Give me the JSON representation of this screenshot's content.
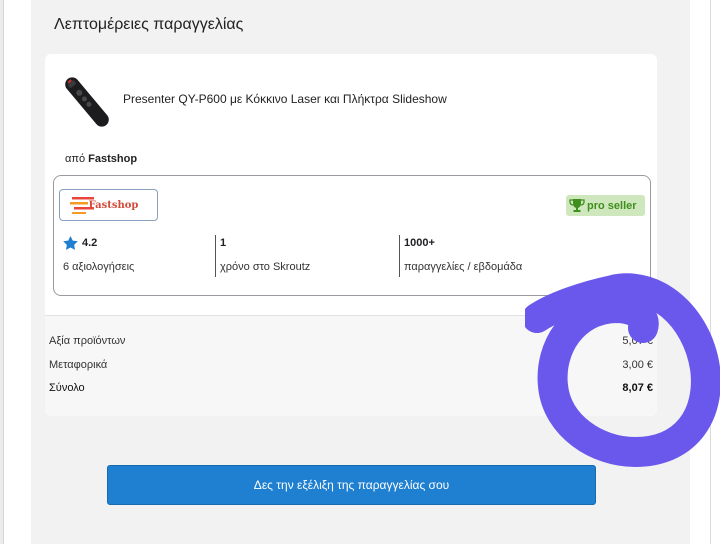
{
  "page": {
    "title": "Λεπτομέρειες παραγγελίας"
  },
  "product": {
    "name": "Presenter QY-P600 με Κόκκινο Laser και Πλήκτρα Slideshow",
    "image_icon": "laser-presenter-remote-icon"
  },
  "seller": {
    "prefix": "από",
    "name": "Fastshop",
    "logo_text": "Fastshop",
    "pro_badge": "pro seller",
    "stats": [
      {
        "value": "4.2",
        "label": "6 αξιολογήσεις",
        "icon": "star-icon"
      },
      {
        "value": "1",
        "label": "χρόνο στο Skroutz"
      },
      {
        "value": "1000+",
        "label": "παραγγελίες / εβδομάδα"
      }
    ]
  },
  "totals": [
    {
      "label": "Αξία προϊόντων",
      "amount": "5,07 €"
    },
    {
      "label": "Μεταφορικά",
      "amount": "3,00 €"
    },
    {
      "label": "Σύνολο",
      "amount": "8,07 €"
    }
  ],
  "cta": {
    "label": "Δες την εξέλιξη της παραγγελίας σου"
  },
  "colors": {
    "accent": "#1f7fd0",
    "annotation_circle": "#6a58ec",
    "pro_badge_bg": "#cfe7bd",
    "star": "#1f7fd0"
  }
}
